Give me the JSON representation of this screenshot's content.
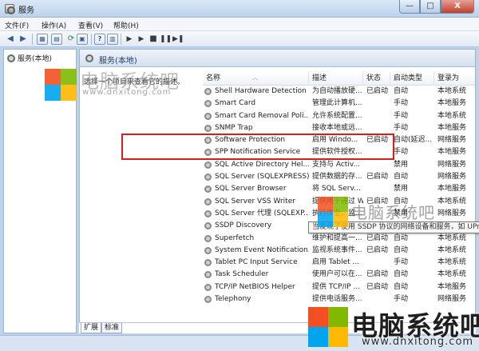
{
  "window": {
    "title": "服务",
    "controls": [
      "—",
      "□",
      "X"
    ]
  },
  "menu": [
    "文件(F)",
    "操作(A)",
    "查看(V)",
    "帮助(H)"
  ],
  "tree": {
    "root_label": "服务(本地)"
  },
  "main": {
    "header_title": "服务(本地)",
    "description": "选择一个项目来查看它的描述。"
  },
  "grid": {
    "columns": [
      "名称",
      "描述",
      "状态",
      "启动类型",
      "登录为"
    ],
    "rows": [
      {
        "name": "Shell Hardware Detection",
        "desc": "为自动播放硬...",
        "status": "已启动",
        "startup": "自动",
        "logon": "本地系统"
      },
      {
        "name": "Smart Card",
        "desc": "管理此计算机...",
        "status": "",
        "startup": "手动",
        "logon": "本地服务"
      },
      {
        "name": "Smart Card Removal Poli...",
        "desc": "允许系统配置...",
        "status": "",
        "startup": "手动",
        "logon": "本地系统"
      },
      {
        "name": "SNMP Trap",
        "desc": "接收本地或远...",
        "status": "",
        "startup": "手动",
        "logon": "本地服务"
      },
      {
        "name": "Software Protection",
        "desc": "启用 Windo...",
        "status": "已启动",
        "startup": "自动(延迟...",
        "logon": "网络服务"
      },
      {
        "name": "SPP Notification Service",
        "desc": "提供软件授权...",
        "status": "",
        "startup": "手动",
        "logon": "本地服务"
      },
      {
        "name": "SQL Active Directory Hel...",
        "desc": "支持与 Activ...",
        "status": "",
        "startup": "禁用",
        "logon": "网络服务"
      },
      {
        "name": "SQL Server (SQLEXPRESS)",
        "desc": "提供数据的存...",
        "status": "已启动",
        "startup": "自动",
        "logon": "网络服务"
      },
      {
        "name": "SQL Server Browser",
        "desc": "将 SQL Serv...",
        "status": "",
        "startup": "禁用",
        "logon": "本地服务"
      },
      {
        "name": "SQL Server VSS Writer",
        "desc": "提供用于通过 Wi...",
        "status": "已启动",
        "startup": "自动",
        "logon": "本地系统"
      },
      {
        "name": "SQL Server 代理 (SQLEXP...",
        "desc": "执行作业、监...",
        "status": "",
        "startup": "禁用",
        "logon": "网络服务"
      },
      {
        "name": "SSDP Discovery",
        "desc": "",
        "status": "",
        "startup": "",
        "logon": ""
      },
      {
        "name": "Superfetch",
        "desc": "维护和提高一...",
        "status": "已启动",
        "startup": "自动",
        "logon": "本地系统"
      },
      {
        "name": "System Event Notification...",
        "desc": "监视系统事件...",
        "status": "已启动",
        "startup": "自动",
        "logon": "本地系统"
      },
      {
        "name": "Tablet PC Input Service",
        "desc": "启用 Tablet ...",
        "status": "",
        "startup": "手动",
        "logon": "本地系统"
      },
      {
        "name": "Task Scheduler",
        "desc": "使用户可以在...",
        "status": "已启动",
        "startup": "自动",
        "logon": "本地系统"
      },
      {
        "name": "TCP/IP NetBIOS Helper",
        "desc": "提供 TCP/IP ...",
        "status": "已启动",
        "startup": "自动",
        "logon": "本地服务"
      },
      {
        "name": "Telephony",
        "desc": "提供电话服务...",
        "status": "",
        "startup": "手动",
        "logon": "网络服务"
      }
    ]
  },
  "tooltip": "当发现了使用 SSDP 协议的网络设备和服务，如 UPnP",
  "tabs": [
    "扩展",
    "标准"
  ],
  "watermarks": {
    "logo_colors": [
      "#f25022",
      "#7fba00",
      "#00a4ef",
      "#ffb900"
    ],
    "brand": "电脑系统吧",
    "url": "www.dnxitong.com"
  }
}
